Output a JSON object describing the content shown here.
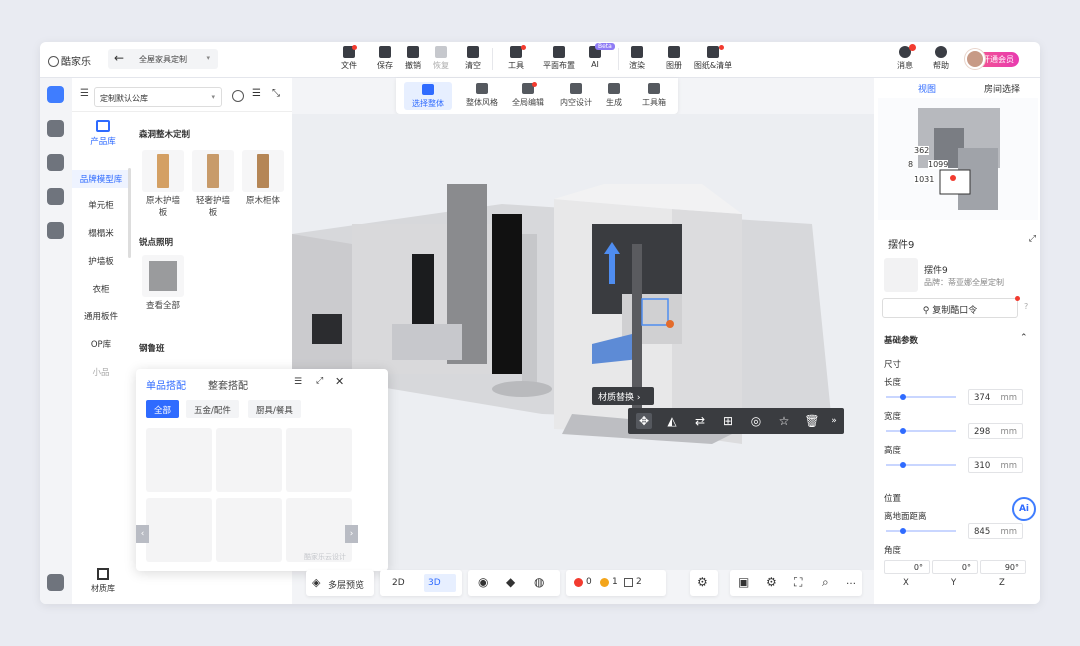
{
  "app": {
    "logo": "酷家乐",
    "doc_title": "全屋家具定制"
  },
  "toolbar": {
    "file": "文件",
    "save": "保存",
    "undo": "撤销",
    "redo": "恢复",
    "clear": "清空",
    "tools": "工具",
    "layout": "平面布置",
    "ai": "AI",
    "ai_badge": "Beta",
    "render": "渲染",
    "album": "图册",
    "drawings": "图纸&清单"
  },
  "topright": {
    "messages": "消息",
    "help": "帮助",
    "vip": "开通会员"
  },
  "subbar": {
    "select_all": "选择整体",
    "style": "整体风格",
    "global_edit": "全局编辑",
    "inner_design": "内空设计",
    "generate": "生成",
    "toolbox": "工具箱"
  },
  "library": {
    "selector": "定制默认公库",
    "product_lib": "产品库",
    "categories": [
      "品牌模型库",
      "单元柜",
      "榻榻米",
      "护墙板",
      "衣柜",
      "通用板件",
      "OP库",
      "小品"
    ],
    "material_lib": "材质库",
    "sections": [
      {
        "title": "森洞整木定制",
        "items": [
          "原木护墙板",
          "轻奢护墙板",
          "原木柜体"
        ]
      },
      {
        "title": "锐点照明",
        "items": [
          "查看全部"
        ]
      },
      {
        "title": "钢鲁班",
        "items": []
      }
    ]
  },
  "floating_panel": {
    "tab_single": "单品搭配",
    "tab_whole": "整套搭配",
    "chips": [
      "全部",
      "五金/配件",
      "厨具/餐具"
    ]
  },
  "canvas": {
    "material_replace": "材质替换",
    "watermark": "酷家乐云设计"
  },
  "bottombar": {
    "multi_floor": "多层预览",
    "mode_2d": "2D",
    "mode_3d": "3D",
    "err_count": "0",
    "warn_count": "1",
    "layer_count": "2"
  },
  "right_panel": {
    "tab_view": "视图",
    "tab_room": "房间选择",
    "minimap_labels": [
      "362",
      "8",
      "1099",
      "1031"
    ],
    "object_title": "摆件9",
    "object_name": "摆件9",
    "brand": "品牌：蒂亚娜全屋定制",
    "copy_cmd": "复制酷口令",
    "basic_params": "基础参数",
    "size": "尺寸",
    "length": "长度",
    "length_val": "374",
    "width": "宽度",
    "width_val": "298",
    "height": "高度",
    "height_val": "310",
    "position": "位置",
    "ground_dist": "离地面距离",
    "ground_val": "845",
    "unit": "mm",
    "angle": "角度",
    "ang_x": "0",
    "ang_y": "0",
    "ang_z": "90",
    "axis_x": "X",
    "axis_y": "Y",
    "axis_z": "Z"
  },
  "ai_button": "Ai",
  "colors": {
    "accent": "#2f6bff",
    "vip_start": "#f55a8b",
    "badge_red": "#f23b2f"
  }
}
